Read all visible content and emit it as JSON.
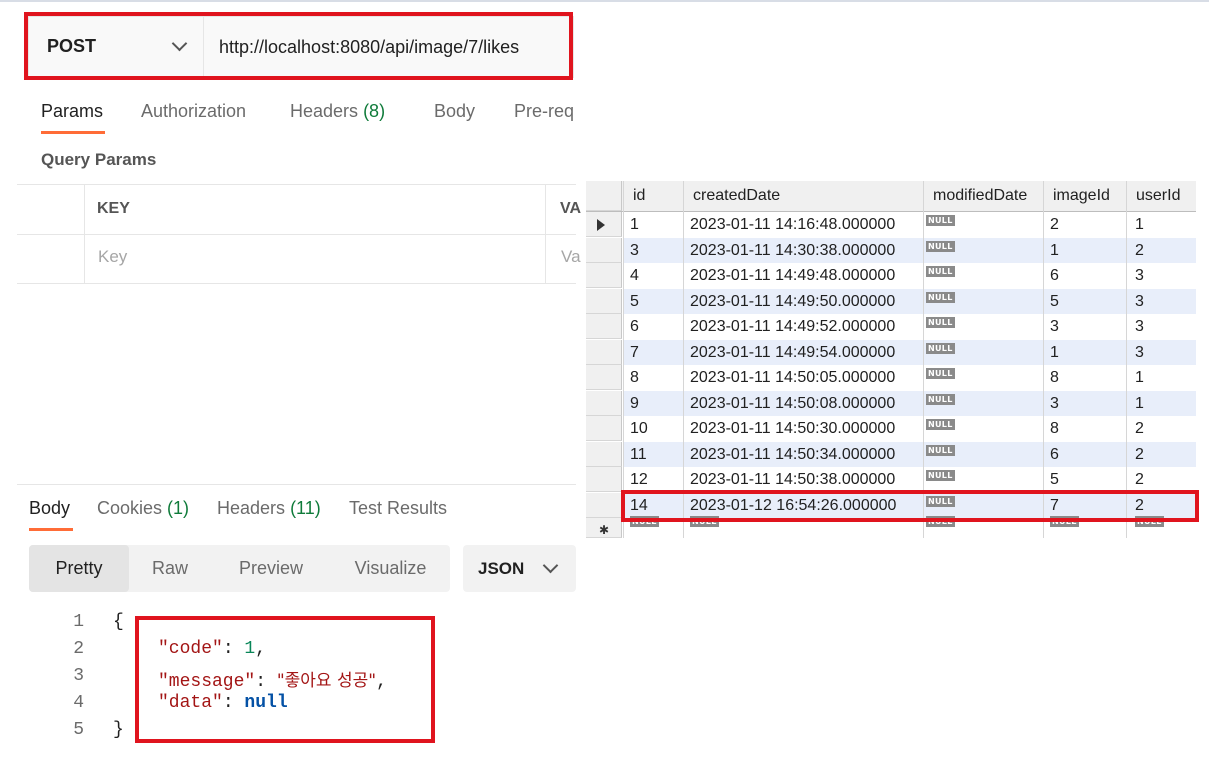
{
  "request": {
    "method": "POST",
    "url": "http://localhost:8080/api/image/7/likes",
    "tabs": [
      {
        "label": "Params",
        "count": ""
      },
      {
        "label": "Authorization",
        "count": ""
      },
      {
        "label": "Headers",
        "count": "(8)"
      },
      {
        "label": "Body",
        "count": ""
      },
      {
        "label": "Pre-req",
        "count": ""
      }
    ],
    "query_params_title": "Query Params",
    "table": {
      "key_header": "KEY",
      "value_header": "VA",
      "key_placeholder": "Key",
      "value_placeholder": "Va"
    }
  },
  "response": {
    "tabs": [
      {
        "label": "Body",
        "count": ""
      },
      {
        "label": "Cookies",
        "count": "(1)"
      },
      {
        "label": "Headers",
        "count": "(11)"
      },
      {
        "label": "Test Results",
        "count": ""
      }
    ],
    "view_modes": [
      "Pretty",
      "Raw",
      "Preview",
      "Visualize"
    ],
    "format": "JSON",
    "line_numbers": [
      "1",
      "2",
      "3",
      "4",
      "5"
    ],
    "open_brace": "{",
    "close_brace": "}",
    "fields": [
      {
        "key": "\"code\"",
        "value": "1",
        "suffix": ","
      },
      {
        "key": "\"message\"",
        "value": "\"좋아요 성공\"",
        "suffix": ","
      },
      {
        "key": "\"data\"",
        "value": "null",
        "suffix": ""
      }
    ]
  },
  "db_grid": {
    "columns": [
      "id",
      "createdDate",
      "modifiedDate",
      "imageId",
      "userId"
    ],
    "null_label": "NULL",
    "rows": [
      {
        "id": "1",
        "createdDate": "2023-01-11 14:16:48.000000",
        "imageId": "2",
        "userId": "1"
      },
      {
        "id": "3",
        "createdDate": "2023-01-11 14:30:38.000000",
        "imageId": "1",
        "userId": "2"
      },
      {
        "id": "4",
        "createdDate": "2023-01-11 14:49:48.000000",
        "imageId": "6",
        "userId": "3"
      },
      {
        "id": "5",
        "createdDate": "2023-01-11 14:49:50.000000",
        "imageId": "5",
        "userId": "3"
      },
      {
        "id": "6",
        "createdDate": "2023-01-11 14:49:52.000000",
        "imageId": "3",
        "userId": "3"
      },
      {
        "id": "7",
        "createdDate": "2023-01-11 14:49:54.000000",
        "imageId": "1",
        "userId": "3"
      },
      {
        "id": "8",
        "createdDate": "2023-01-11 14:50:05.000000",
        "imageId": "8",
        "userId": "1"
      },
      {
        "id": "9",
        "createdDate": "2023-01-11 14:50:08.000000",
        "imageId": "3",
        "userId": "1"
      },
      {
        "id": "10",
        "createdDate": "2023-01-11 14:50:30.000000",
        "imageId": "8",
        "userId": "2"
      },
      {
        "id": "11",
        "createdDate": "2023-01-11 14:50:34.000000",
        "imageId": "6",
        "userId": "2"
      },
      {
        "id": "12",
        "createdDate": "2023-01-11 14:50:38.000000",
        "imageId": "5",
        "userId": "2"
      },
      {
        "id": "14",
        "createdDate": "2023-01-12 16:54:26.000000",
        "imageId": "7",
        "userId": "2"
      }
    ],
    "colors": {
      "highlight": "#e0141e",
      "alt_row": "#e8eefa"
    }
  }
}
